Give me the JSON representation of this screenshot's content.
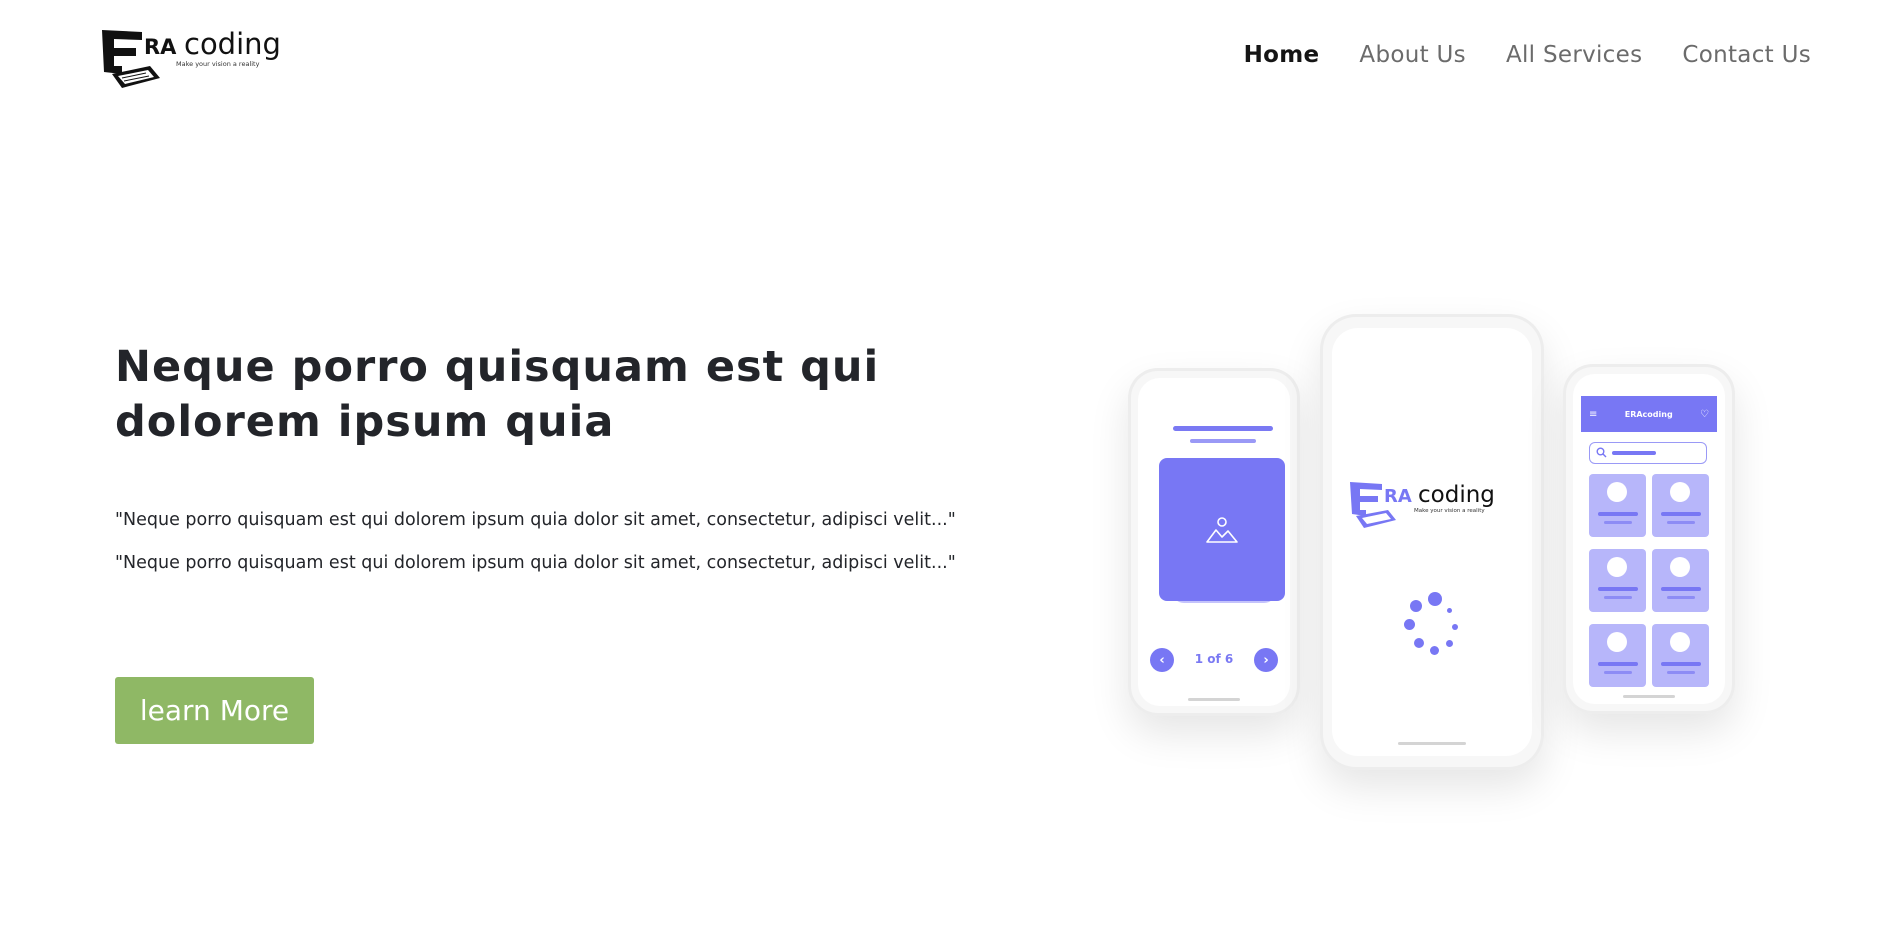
{
  "header": {
    "logo": {
      "brand_prefix": "E",
      "brand_accent": "RA",
      "brand_rest": "coding",
      "tagline": "Make your vision a reality"
    },
    "nav": [
      {
        "label": "Home",
        "active": true
      },
      {
        "label": "About Us",
        "active": false
      },
      {
        "label": "All Services",
        "active": false
      },
      {
        "label": "Contact Us",
        "active": false
      }
    ]
  },
  "hero": {
    "title": "Neque porro quisquam est qui dolorem ipsum quia",
    "paragraph_1": "\"Neque porro quisquam est qui dolorem ipsum quia dolor sit amet, consectetur, adipisci velit...\"",
    "paragraph_2": "\"Neque porro quisquam est qui dolorem ipsum quia dolor sit amet, consectetur, adipisci velit...\"",
    "cta_label": "learn More"
  },
  "mockups": {
    "left_phone": {
      "counter": "1 of 6"
    },
    "center_phone": {
      "brand_prefix": "E",
      "brand_accent": "RA",
      "brand_rest": "coding",
      "tagline": "Make your vision a reality"
    },
    "right_phone": {
      "brand": "ERAcoding"
    }
  },
  "colors": {
    "accent": "#7877f4",
    "cta": "#8fb865",
    "nav_active": "#151515",
    "nav_inactive": "#6b6b6b",
    "text": "#23252a"
  },
  "icons": [
    "laptop-logo-icon",
    "image-placeholder-icon",
    "chevron-left-icon",
    "chevron-right-icon",
    "menu-icon",
    "heart-icon",
    "search-icon",
    "loading-spinner-icon"
  ]
}
